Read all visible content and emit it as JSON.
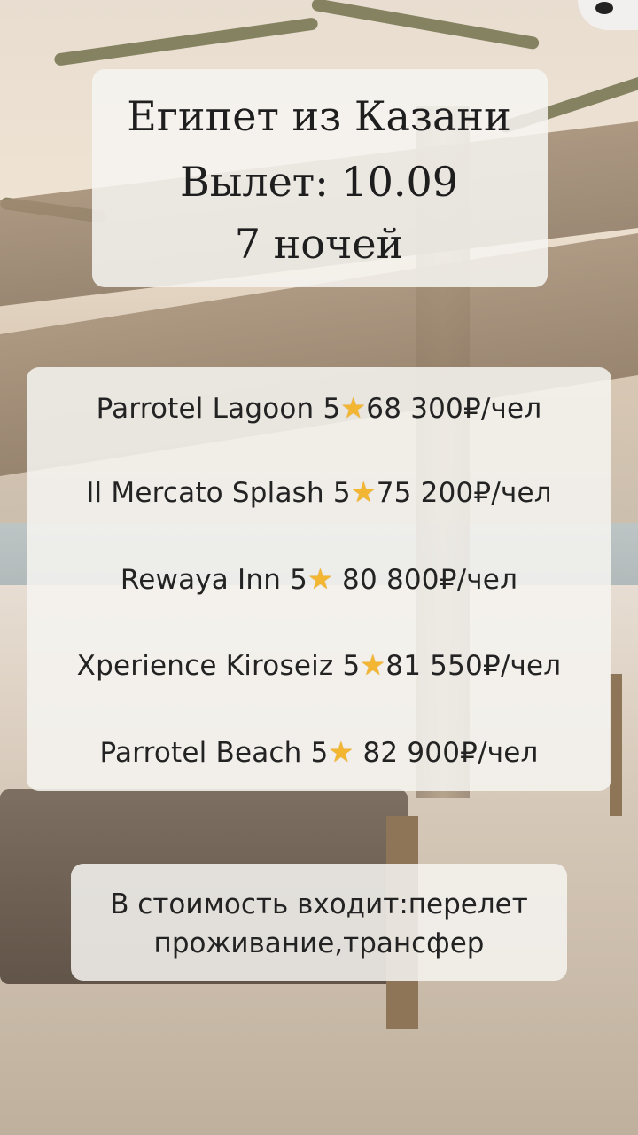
{
  "title": {
    "line1": "Египет из Казани",
    "line2": "Вылет: 10.09",
    "line3": "7 ночей"
  },
  "hotels": [
    {
      "name": "Parrotel Lagoon",
      "stars": "5",
      "star_icon": "star-icon",
      "price": "68 300₽/чел"
    },
    {
      "name": "Il Mercato Splash",
      "stars": "5",
      "star_icon": "star-icon",
      "price": "75 200₽/чел"
    },
    {
      "name": "Rewaya Inn",
      "stars": "5",
      "star_icon": "star-icon",
      "price": " 80 800₽/чел"
    },
    {
      "name": "Xperience Kiroseiz",
      "stars": "5",
      "star_icon": "star-icon",
      "price": "81 550₽/чел"
    },
    {
      "name": "Parrotel Beach",
      "stars": "5",
      "star_icon": "star-icon",
      "price": " 82 900₽/чел"
    }
  ],
  "footer": {
    "line1": "В стоимость входит:перелет",
    "line2": "проживание,трансфер"
  },
  "colors": {
    "card_bg": "#f6f4f1",
    "star": "#f2b632",
    "text": "#232323"
  }
}
